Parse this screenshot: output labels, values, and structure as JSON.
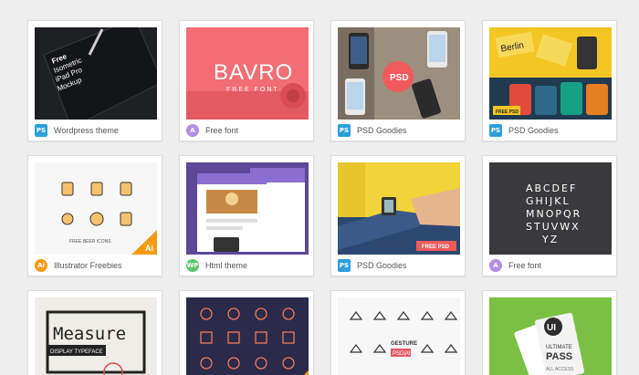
{
  "cards": [
    {
      "badge": "PS",
      "label": "Wordpress theme",
      "overlay": [
        "Free",
        "Isometric",
        "iPad Pro",
        "Mockup"
      ]
    },
    {
      "badge": "A",
      "label": "Free font",
      "overlay": [
        "BAVRO",
        "FREE FONT"
      ]
    },
    {
      "badge": "PS",
      "label": "PSD Goodies",
      "overlay": [
        "PSD"
      ]
    },
    {
      "badge": "PS",
      "label": "PSD Goodies",
      "overlay": [
        "Berlin",
        "FREE PSD"
      ]
    },
    {
      "badge": "Ai",
      "label": "Illustrator Freebies",
      "overlay": [
        "FREE BEER ICONS",
        "Ai"
      ]
    },
    {
      "badge": "WP",
      "label": "Html theme",
      "overlay": []
    },
    {
      "badge": "PS",
      "label": "PSD Goodies",
      "overlay": [
        "FREE PSD"
      ]
    },
    {
      "badge": "A",
      "label": "Free font",
      "overlay": [
        "ABCDEF",
        "GHIJKL",
        "MNOPQR",
        "STUVWX",
        "YZ"
      ]
    },
    {
      "badge": "",
      "label": "",
      "overlay": [
        "Measure",
        "DISPLAY TYPEFACE"
      ]
    },
    {
      "badge": "",
      "label": "",
      "overlay": []
    },
    {
      "badge": "",
      "label": "",
      "overlay": [
        "GESTURE",
        "PSD|AI"
      ]
    },
    {
      "badge": "",
      "label": "",
      "overlay": [
        "UI",
        "ULTIMATE",
        "PASS",
        "ALL ACCESS"
      ]
    }
  ],
  "colors": {
    "ps": "#2d9fdb",
    "ai": "#f39c12",
    "font": "#b48ee3",
    "wp": "#5ec46b"
  }
}
